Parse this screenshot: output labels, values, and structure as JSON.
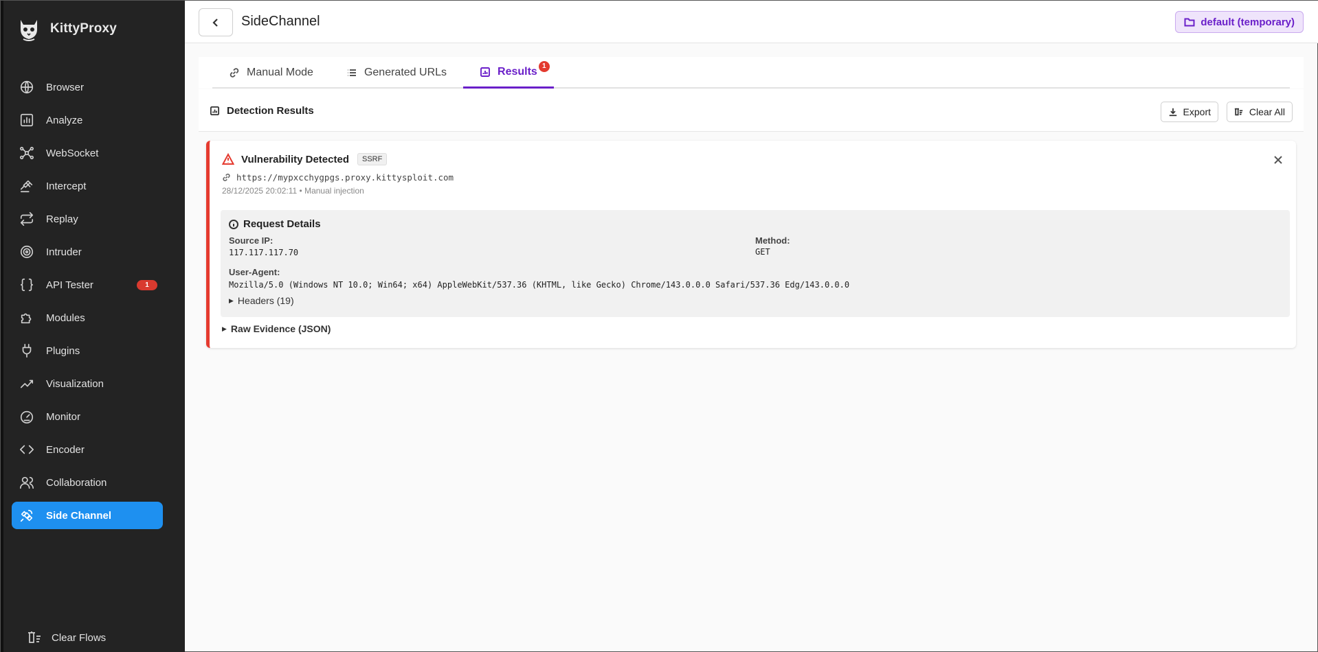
{
  "app": {
    "name": "KittyProxy"
  },
  "sidebar": {
    "items": [
      {
        "label": "Browser",
        "icon": "globe-icon"
      },
      {
        "label": "Analyze",
        "icon": "bar-chart-icon"
      },
      {
        "label": "WebSocket",
        "icon": "network-icon"
      },
      {
        "label": "Intercept",
        "icon": "gavel-icon"
      },
      {
        "label": "Replay",
        "icon": "repeat-icon"
      },
      {
        "label": "Intruder",
        "icon": "target-icon"
      },
      {
        "label": "API Tester",
        "icon": "braces-icon",
        "badge": "1"
      },
      {
        "label": "Modules",
        "icon": "puzzle-icon"
      },
      {
        "label": "Plugins",
        "icon": "plug-icon"
      },
      {
        "label": "Visualization",
        "icon": "line-chart-icon"
      },
      {
        "label": "Monitor",
        "icon": "gauge-icon"
      },
      {
        "label": "Encoder",
        "icon": "code-icon"
      },
      {
        "label": "Collaboration",
        "icon": "users-icon"
      },
      {
        "label": "Side Channel",
        "icon": "satellite-icon",
        "active": true
      }
    ],
    "clear_flows": "Clear Flows"
  },
  "header": {
    "title": "SideChannel",
    "workspace": "default (temporary)"
  },
  "tabs": [
    {
      "label": "Manual Mode",
      "icon": "link-icon"
    },
    {
      "label": "Generated URLs",
      "icon": "list-icon"
    },
    {
      "label": "Results",
      "icon": "chart-icon",
      "badge": "1",
      "active": true
    }
  ],
  "results": {
    "title": "Detection Results",
    "export_label": "Export",
    "clear_all_label": "Clear All"
  },
  "finding": {
    "title": "Vulnerability Detected",
    "tag": "SSRF",
    "url": "https://mypxcchygpgs.proxy.kittysploit.com",
    "meta": "28/12/2025 20:02:11 • Manual injection",
    "details_title": "Request Details",
    "source_ip_label": "Source IP:",
    "source_ip": "117.117.117.70",
    "method_label": "Method:",
    "method": "GET",
    "user_agent_label": "User-Agent:",
    "user_agent": "Mozilla/5.0 (Windows NT 10.0; Win64; x64) AppleWebKit/537.36 (KHTML, like Gecko) Chrome/143.0.0.0 Safari/537.36 Edg/143.0.0.0",
    "headers_label": "Headers (19)",
    "raw_label": "Raw Evidence (JSON)"
  },
  "colors": {
    "sidebar_bg": "#232323",
    "active_nav": "#1e90f0",
    "accent": "#6a1fc9",
    "danger": "#e53a2f"
  }
}
